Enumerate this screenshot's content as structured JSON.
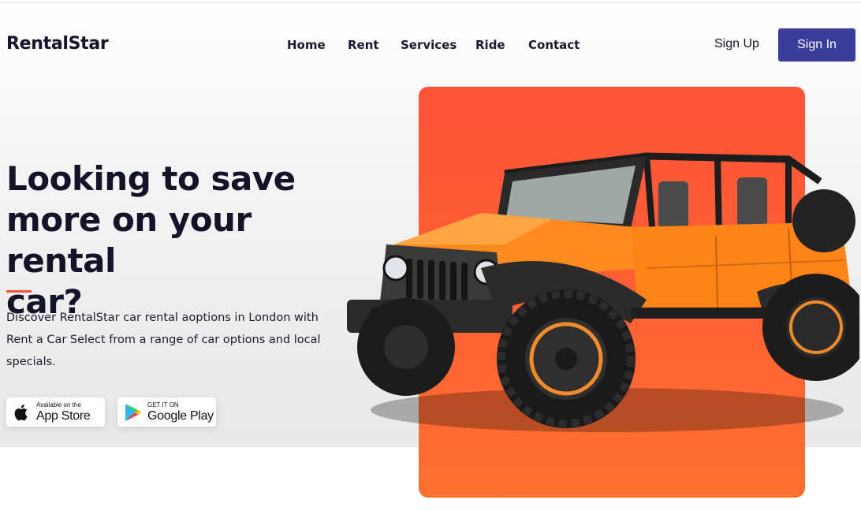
{
  "header": {
    "logo": "RentalStar",
    "nav": [
      "Home",
      "Rent",
      "Services",
      "Ride",
      "Contact"
    ],
    "sign_up_label": "Sign Up",
    "sign_in_label": "Sign In"
  },
  "hero": {
    "headline_lines": [
      "Looking to save",
      "more on your rental",
      "car?"
    ],
    "description": "Discover RentalStar car rental aoptions in London with Rent a Car Select from a range of car options and local specials.",
    "app_store": {
      "small": "Available on the",
      "big": "App Store"
    },
    "google_play": {
      "small": "GET IT ON",
      "big": "Google Play"
    },
    "accent_color": "#f2533b",
    "card_color": "#ff5e35",
    "car_color": "#ff8a1e"
  },
  "colors": {
    "primary_button": "#3b3d9a",
    "text_dark": "#13132a"
  }
}
